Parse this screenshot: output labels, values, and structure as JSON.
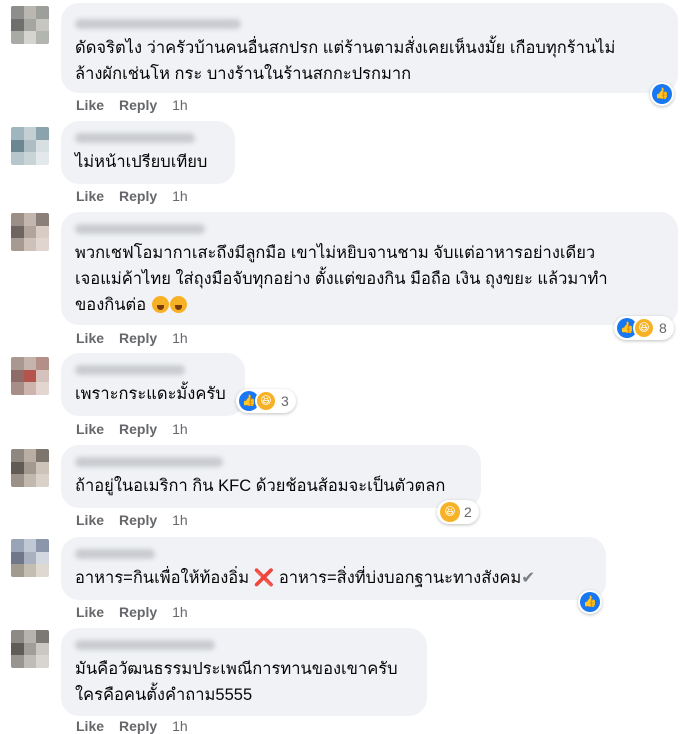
{
  "comments": [
    {
      "text": "ดัดจริตไง ว่าครัวบ้านคนอื่นสกปรก แต่ร้านตามสั่งเคยเห็นงมั้ย เกือบทุกร้านไม่\nล้างผักเช่นโห กระ บางร้านในร้านสกกะปรกมาก",
      "like": "Like",
      "reply": "Reply",
      "time": "1h",
      "reactions": {
        "types": [
          "like"
        ],
        "count": ""
      }
    },
    {
      "text": "ไม่หน้าเปรียบเทียบ",
      "like": "Like",
      "reply": "Reply",
      "time": "1h",
      "reactions": null
    },
    {
      "text": "พวกเชฟโอมากาเสะถึงมีลูกมือ เขาไม่หยิบจานชาม จับแต่อาหารอย่างเดียว\nเจอแม่ค้าไทย ใส่ถุงมือจับทุกอย่าง ตั้งแต่ของกิน มือถือ เงิน ถุงขยะ แล้วมาทำ\nของกินต่อ",
      "emojis": [
        "😱",
        "😱"
      ],
      "like": "Like",
      "reply": "Reply",
      "time": "1h",
      "reactions": {
        "types": [
          "like",
          "haha"
        ],
        "count": "8"
      }
    },
    {
      "text": "เพราะกระแดะมั้งครับ",
      "like": "Like",
      "reply": "Reply",
      "time": "1h",
      "reactions": {
        "types": [
          "like",
          "haha"
        ],
        "count": "3"
      }
    },
    {
      "text": "ถ้าอยู่ในอเมริกา กิน KFC ด้วยช้อนส้อมจะเป็นตัวตลก",
      "like": "Like",
      "reply": "Reply",
      "time": "1h",
      "reactions": {
        "types": [
          "haha"
        ],
        "count": "2"
      }
    },
    {
      "text_a": "อาหาร=กินเพื่อให้ท้องอิ่ม",
      "cross": "❌",
      "text_b": "อาหาร=สิ่งที่บ่งบอกฐานะทางสังคม",
      "check": "✔",
      "like": "Like",
      "reply": "Reply",
      "time": "1h",
      "reactions": {
        "types": [
          "like"
        ],
        "count": ""
      }
    },
    {
      "text": "มันคือวัฒนธรรมประเพณีการทานของเขาครับ\nใครคือคนตั้งคำถาม5555",
      "like": "Like",
      "reply": "Reply",
      "time": "1h",
      "reactions": null
    }
  ],
  "reaction_icons": {
    "like": "👍",
    "haha": "😆"
  },
  "colors": {
    "bubble": "#f0f2f5",
    "like_blue": "#1877f2",
    "haha_yellow": "#f7b125",
    "meta_gray": "#65676b"
  }
}
